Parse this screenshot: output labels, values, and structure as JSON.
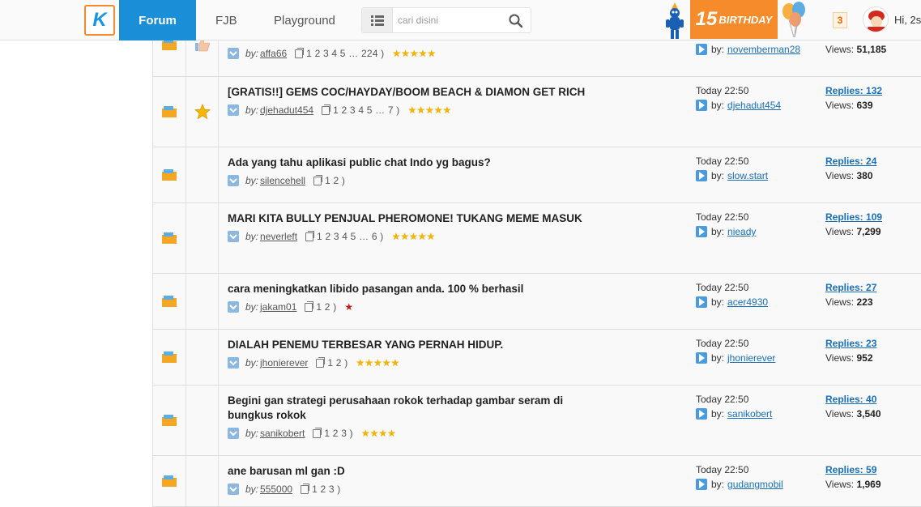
{
  "header": {
    "logo_text": "K",
    "nav": {
      "forum": "Forum",
      "fjb": "FJB",
      "playground": "Playground"
    },
    "search_placeholder": "cari disini",
    "birthday_number": "15",
    "birthday_text": "BIRTHDAY",
    "notification_count": "3",
    "greeting": "Hi, 2s"
  },
  "labels": {
    "by": "by:",
    "lp_by": "by:",
    "replies": "Replies:",
    "views": "Views:"
  },
  "threads": [
    {
      "title": "",
      "author": "affa66",
      "pages": "1   2   3   4   5  …  224  )",
      "rating": 5,
      "last_time": "",
      "last_user": "novemberman28",
      "replies": "",
      "views": "51,185",
      "badge": "thumb"
    },
    {
      "title": "[GRATIS!!] GEMS COC/HAYDAY/BOOM BEACH & DIAMON GET RICH",
      "author": "djehadut454",
      "pages": "1   2   3   4   5  …  7  )",
      "rating": 5,
      "last_time": "Today 22:50",
      "last_user": "djehadut454",
      "replies": "132",
      "views": "639",
      "badge": "star"
    },
    {
      "title": "Ada yang tahu aplikasi public chat Indo yg bagus?",
      "author": "silencehell",
      "pages": "1   2  )",
      "rating": 0,
      "last_time": "Today 22:50",
      "last_user": "slow.start",
      "replies": "24",
      "views": "380",
      "badge": ""
    },
    {
      "title": "MARI KITA BULLY PENJUAL PHEROMONE! TUKANG MEME MASUK",
      "author": "neverleft",
      "pages": "1   2   3   4   5  …  6  )",
      "rating": 5,
      "last_time": "Today 22:50",
      "last_user": "nieady",
      "replies": "109",
      "views": "7,299",
      "badge": ""
    },
    {
      "title": "cara meningkatkan libido pasangan anda. 100 % berhasil",
      "author": "jakam01",
      "pages": "1   2  )",
      "rating": -1,
      "last_time": "Today 22:50",
      "last_user": "acer4930",
      "replies": "27",
      "views": "223",
      "badge": ""
    },
    {
      "title": "DIALAH PENEMU TERBESAR YANG PERNAH HIDUP.",
      "author": "jhonierever",
      "pages": "1   2  )",
      "rating": 5,
      "last_time": "Today 22:50",
      "last_user": "jhonierever",
      "replies": "23",
      "views": "952",
      "badge": ""
    },
    {
      "title": "Begini gan strategi perusahaan rokok terhadap gambar seram di bungkus rokok",
      "author": "sanikobert",
      "pages": "1   2   3  )",
      "rating": 4,
      "last_time": "Today 22:50",
      "last_user": "sanikobert",
      "replies": "40",
      "views": "3,540",
      "badge": ""
    },
    {
      "title": "ane barusan ml gan :D",
      "author": "555000",
      "pages": "1   2   3  )",
      "rating": 0,
      "last_time": "Today 22:50",
      "last_user": "gudangmobil",
      "replies": "59",
      "views": "1,969",
      "badge": ""
    }
  ]
}
